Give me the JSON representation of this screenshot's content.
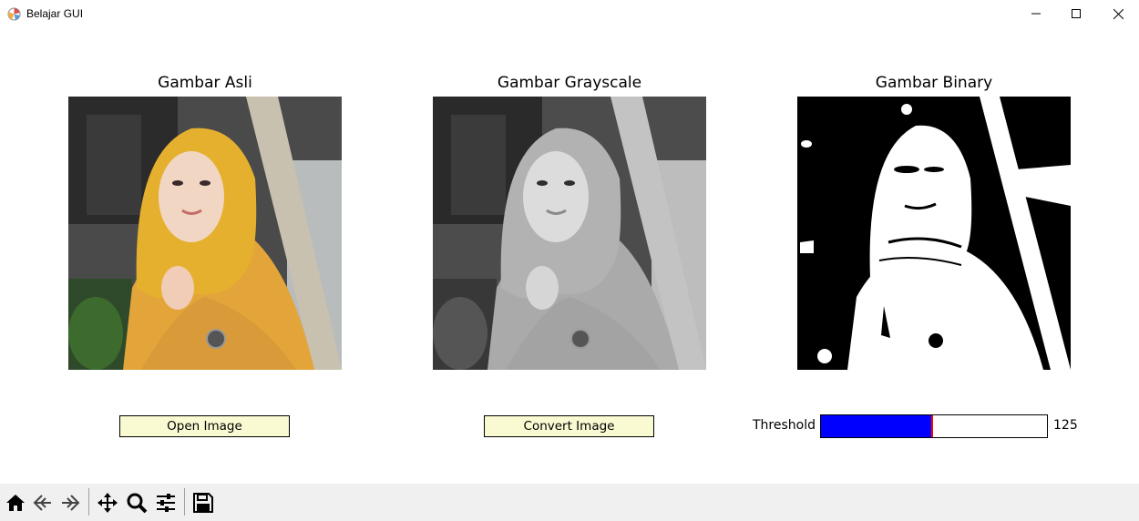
{
  "window": {
    "title": "Belajar GUI"
  },
  "panels": [
    {
      "title": "Gambar Asli"
    },
    {
      "title": "Gambar Grayscale"
    },
    {
      "title": "Gambar Binary"
    }
  ],
  "buttons": {
    "open_image": "Open Image",
    "convert_image": "Convert Image"
  },
  "threshold": {
    "label": "Threshold",
    "value": "125",
    "min": 0,
    "max": 255
  },
  "toolbar": {
    "icons": [
      "home-icon",
      "back-icon",
      "forward-icon",
      "pan-icon",
      "zoom-icon",
      "configure-subplots-icon",
      "save-icon"
    ]
  },
  "colors": {
    "button_bg": "#fafad2",
    "slider_fill": "#0000ff",
    "slider_handle": "#ff0000",
    "toolbar_bg": "#f0f0f0"
  }
}
